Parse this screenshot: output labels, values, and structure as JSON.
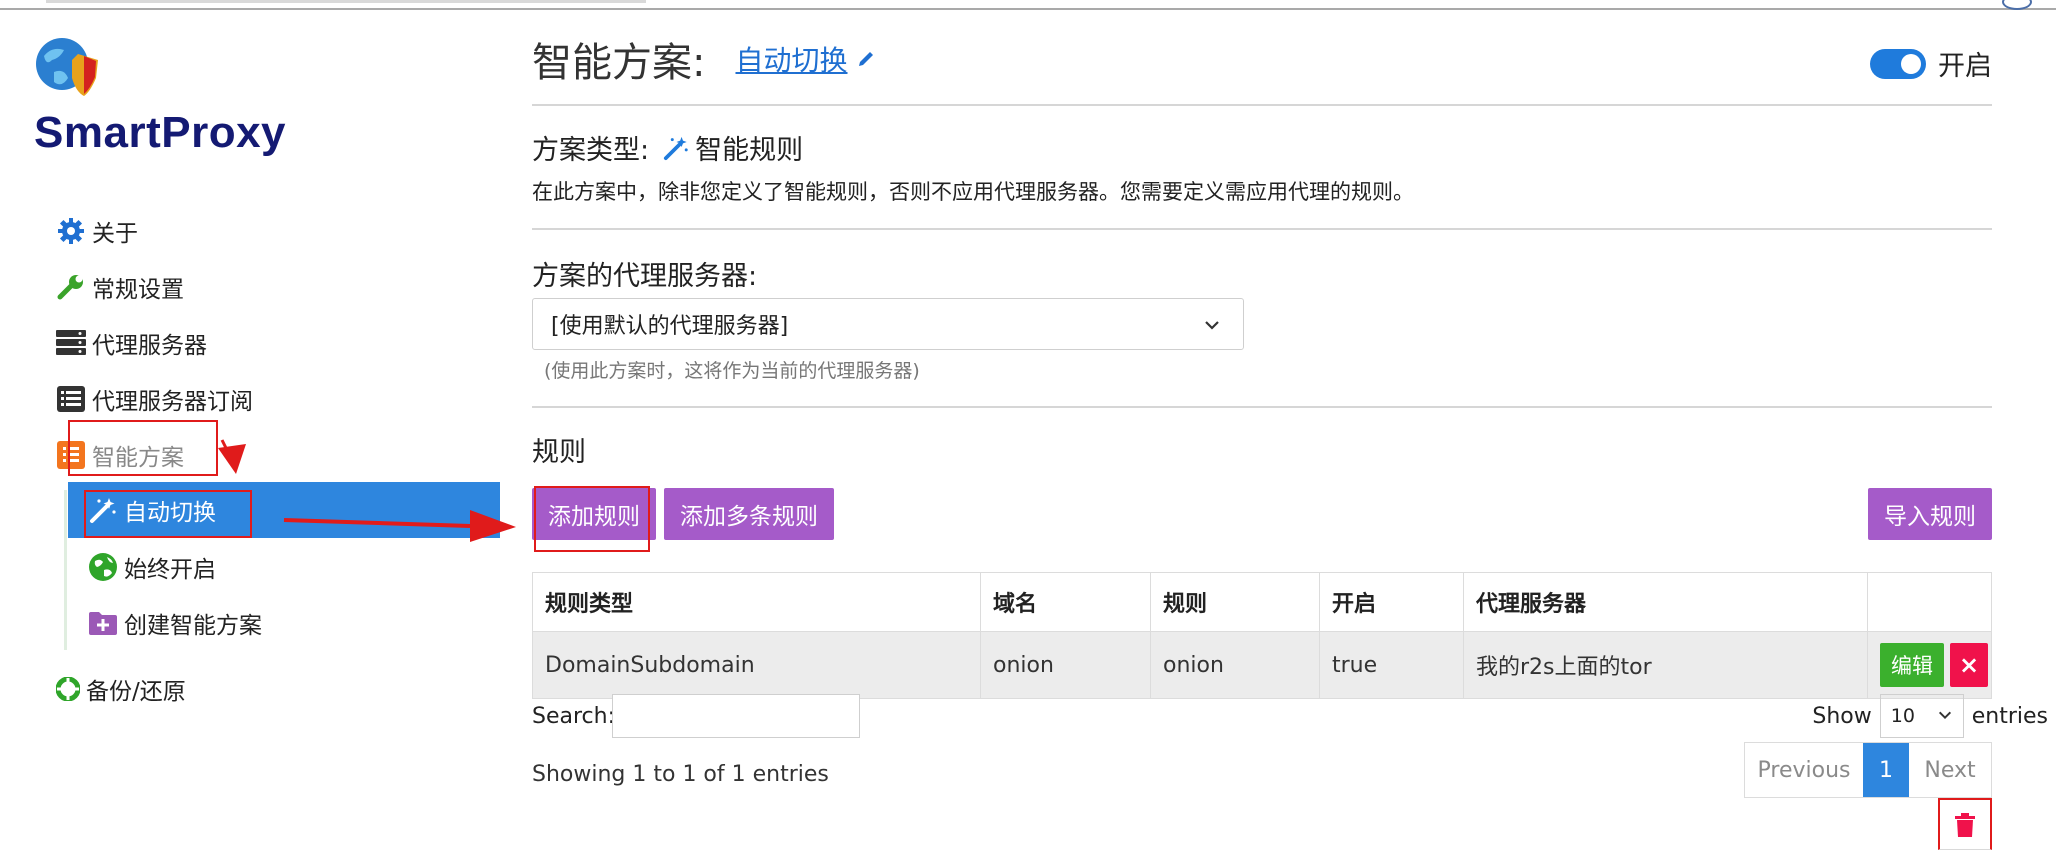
{
  "app": {
    "brand": "SmartProxy"
  },
  "sidebar": {
    "items": [
      {
        "label": "关于",
        "icon": "gear-icon"
      },
      {
        "label": "常规设置",
        "icon": "wrench-icon"
      },
      {
        "label": "代理服务器",
        "icon": "server-icon"
      },
      {
        "label": "代理服务器订阅",
        "icon": "list-icon"
      },
      {
        "label": "智能方案",
        "icon": "list-orange-icon"
      }
    ],
    "sub_items": [
      {
        "label": "自动切换",
        "icon": "magic-wand-icon",
        "active": true
      },
      {
        "label": "始终开启",
        "icon": "globe-icon"
      },
      {
        "label": "创建智能方案",
        "icon": "folder-plus-icon"
      }
    ],
    "backup": {
      "label": "备份/还原",
      "icon": "lifebuoy-icon"
    }
  },
  "header": {
    "title": "智能方案:",
    "profile_name": "自动切换",
    "toggle_label": "开启",
    "toggle_on": true
  },
  "profile": {
    "type_label": "方案类型:",
    "type_value": "智能规则",
    "description": "在此方案中，除非您定义了智能规则，否则不应用代理服务器。您需要定义需应用代理的规则。",
    "proxy_label": "方案的代理服务器:",
    "proxy_selected": "[使用默认的代理服务器]",
    "proxy_hint": "(使用此方案时，这将作为当前的代理服务器)"
  },
  "rules": {
    "title": "规则",
    "add_button": "添加规则",
    "add_multi_button": "添加多条规则",
    "import_button": "导入规则",
    "columns": [
      "规则类型",
      "域名",
      "规则",
      "开启",
      "代理服务器"
    ],
    "rows": [
      {
        "type": "DomainSubdomain",
        "domain": "onion",
        "rule": "onion",
        "enabled": "true",
        "proxy": "我的r2s上面的tor",
        "edit": "编辑",
        "delete": "×"
      }
    ],
    "search_label": "Search:",
    "search_value": "",
    "show_label": "Show",
    "page_size": "10",
    "entries_label": "entries",
    "info": "Showing 1 to 1 of 1 entries",
    "pager": {
      "previous": "Previous",
      "current": "1",
      "next": "Next"
    }
  },
  "colors": {
    "accent": "#2e86de",
    "purple": "#a55bc9",
    "green": "#3bb02d",
    "danger": "#f0124b",
    "brand": "#141a73",
    "annotation": "#e01b1b"
  }
}
